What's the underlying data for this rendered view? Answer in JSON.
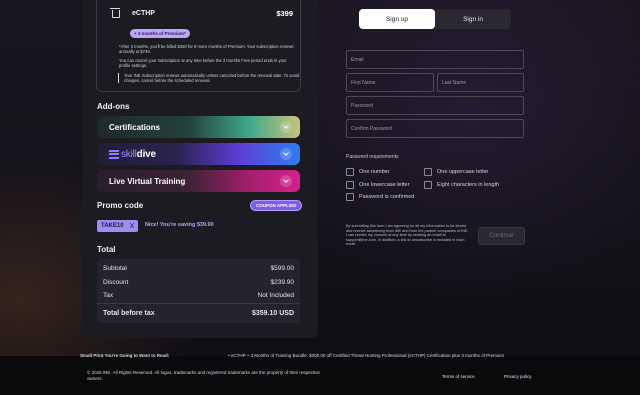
{
  "product": {
    "name": "eCTHP",
    "price": "$399",
    "premium_pill": "+ 3 months of Premium*",
    "fine_1": "*After 3 months, you'll be billed $350 for 9 more months of Premium. Your subscription renews annually at $749.",
    "fine_2": "You can cancel your subscription at any time before the 3 months Free period ends in your profile settings.",
    "notice": "Your INE Subscription renews automatically unless canceled before the renewal date. To avoid charges, cancel before the scheduled renewal."
  },
  "addons": {
    "title": "Add-ons",
    "certifications": "Certifications",
    "skilldive_skill": "skill",
    "skilldive_dive": "dive",
    "live_training": "Live Virtual Training"
  },
  "promo": {
    "title": "Promo code",
    "applied_badge": "COUPON APPLIED",
    "code": "TAKE10",
    "remove": "X",
    "saving": "Nice! You're saving $39.90"
  },
  "total": {
    "title": "Total",
    "rows": [
      {
        "label": "Subtotal",
        "value": "$599.00"
      },
      {
        "label": "Discount",
        "value": "$239.90"
      },
      {
        "label": "Tax",
        "value": "Not Included"
      }
    ],
    "final_label": "Total before tax",
    "final_value": "$359.10 USD"
  },
  "auth": {
    "signup": "Sign up",
    "signin": "Sign in",
    "email": "Email",
    "first_name": "First Name",
    "last_name": "Last Name",
    "password": "Password",
    "confirm_password": "Confirm Password"
  },
  "password_requirements": {
    "title": "Password requirements",
    "one_number": "One number",
    "one_uppercase": "One uppercase letter",
    "one_lowercase": "One lowercase letter",
    "eight_chars": "Eight characters in length",
    "confirmed": "Password is confirmed"
  },
  "consent": "By submitting this form I am agreeing for all my information to be stored and receive advertising from INE and from the partner companies of INE. I can revoke my consent at any time by sending an email to support@ine.com. In addition, a link to unsubscribe is included in each email.",
  "continue_label": "Continue",
  "footer": {
    "smallprint": "Small Print You're Going to Want to Read:",
    "bundle": "• eCTHP + 3 Months of Training Bundle: $200.00 off Certified Threat Hunting Professional (eCTHP) Certification plus 3 months of Premium",
    "copyright": "© 2025 INE. All Rights Reserved. All logos, trademarks and registered trademarks are the property of their respective owners.",
    "terms": "Terms of service",
    "privacy": "Privacy policy"
  }
}
